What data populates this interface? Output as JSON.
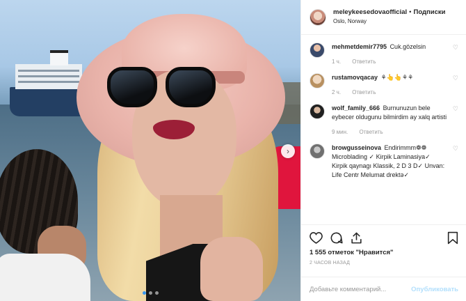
{
  "post": {
    "username": "meleykeesedovaofficial",
    "dot": "•",
    "follow_label": "Подписки",
    "location": "Oslo, Norway",
    "likes": "1 555 отметок \"Нравится\"",
    "timestamp": "2 часов назад",
    "carousel": {
      "slides": 3,
      "active_index": 0
    }
  },
  "comments": [
    {
      "user": "mehmetdemir7795",
      "text": "Cuk.gözelsin",
      "time": "1 ч.",
      "reply": "Ответить"
    },
    {
      "user": "rustamovqacay",
      "text": "⚘👆👆⚘⚘",
      "time": "2 ч.",
      "reply": "Ответить"
    },
    {
      "user": "wolf_family_666",
      "text": "Burnunuzun bele eybecer oldugunu bilmirdim ay xalq artisti",
      "time": "9 мин.",
      "reply": "Ответить"
    },
    {
      "user": "browgusseinova",
      "text": "Endirimmm❁❁ Microblading ✓ Kirpik Laminasiya✓ Kirpik qaynagı Klassik, 2 D 3 D✓ Unvan: Life Centr Melumat drektə✓",
      "time": "",
      "reply": ""
    }
  ],
  "add_comment": {
    "placeholder": "Добавьте комментарий...",
    "publish_label": "Опубликовать"
  },
  "icons": {
    "heart": "heart-icon",
    "comment": "comment-icon",
    "share": "share-icon",
    "bookmark": "bookmark-icon",
    "next": "chevron-right-icon"
  },
  "colors": {
    "link": "#3897f0",
    "publish_disabled": "#b2dffc",
    "meta": "#999999"
  }
}
